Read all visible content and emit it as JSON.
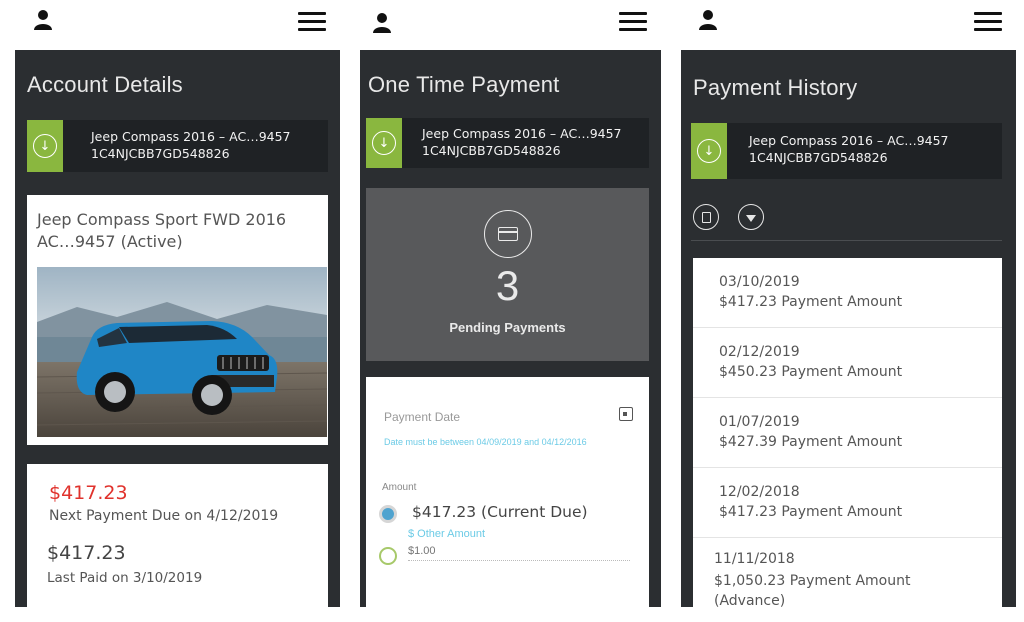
{
  "vehicle": {
    "line1": "Jeep Compass 2016 – AC…9457",
    "line2": "1C4NJCBB7GD548826"
  },
  "account": {
    "title": "Account Details",
    "car_name": "Jeep Compass Sport FWD 2016 AC…9457 (Active)",
    "due_amount": "$417.23",
    "due_label": "Next Payment Due on 4/12/2019",
    "paid_amount": "$417.23",
    "paid_label": "Last Paid on 3/10/2019",
    "colors": {
      "due": "#e0322c",
      "accent": "#8ab73f"
    }
  },
  "one_time": {
    "title": "One Time Payment",
    "pending_count": "3",
    "pending_label": "Pending Payments",
    "date_label": "Payment Date",
    "date_hint": "Date must be between 04/09/2019 and 04/12/2016",
    "amount_label": "Amount",
    "option_current": "$417.23 (Current Due)",
    "option_other_label": "$ Other Amount",
    "option_other_placeholder": "$1.00"
  },
  "history": {
    "title": "Payment History",
    "items": [
      {
        "date": "03/10/2019",
        "amount": "$417.23 Payment Amount"
      },
      {
        "date": "02/12/2019",
        "amount": "$450.23 Payment Amount"
      },
      {
        "date": "01/07/2019",
        "amount": "$427.39 Payment Amount"
      },
      {
        "date": "12/02/2018",
        "amount": "$417.23 Payment Amount"
      },
      {
        "date": "11/11/2018",
        "amount": "$1,050.23 Payment Amount (Advance)"
      }
    ]
  },
  "icons": [
    "user-icon",
    "menu-icon",
    "download-circle-icon",
    "credit-card-icon",
    "calendar-icon",
    "export-icon",
    "filter-icon"
  ]
}
